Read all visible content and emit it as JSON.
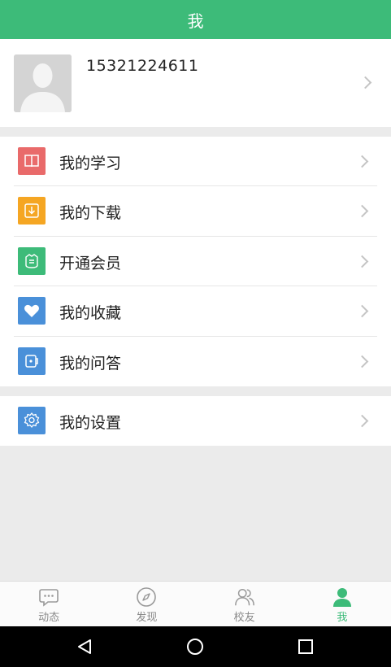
{
  "header": {
    "title": "我"
  },
  "profile": {
    "phone": "15321224611",
    "avatar": "default-person-avatar"
  },
  "menu": {
    "group1": [
      {
        "label": "我的学习",
        "icon": "book-icon",
        "color": "#e96a6a"
      },
      {
        "label": "我的下载",
        "icon": "download-icon",
        "color": "#f5a623"
      },
      {
        "label": "开通会员",
        "icon": "member-badge-icon",
        "color": "#3dbb79"
      },
      {
        "label": "我的收藏",
        "icon": "heart-icon",
        "color": "#4a90d9"
      },
      {
        "label": "我的问答",
        "icon": "qa-icon",
        "color": "#4a90d9"
      }
    ],
    "group2": [
      {
        "label": "我的设置",
        "icon": "gear-icon",
        "color": "#4a90d9"
      }
    ]
  },
  "tabbar": {
    "tabs": [
      {
        "label": "动态",
        "icon": "chat-bubble-icon",
        "active": false
      },
      {
        "label": "发现",
        "icon": "compass-icon",
        "active": false
      },
      {
        "label": "校友",
        "icon": "people-icon",
        "active": false
      },
      {
        "label": "我",
        "icon": "person-icon",
        "active": true
      }
    ],
    "active_color": "#3dbb79"
  },
  "system_nav": {
    "buttons": [
      "back-icon",
      "home-icon",
      "recents-icon"
    ]
  },
  "colors": {
    "brand": "#3dbb79",
    "background": "#ebebeb"
  }
}
